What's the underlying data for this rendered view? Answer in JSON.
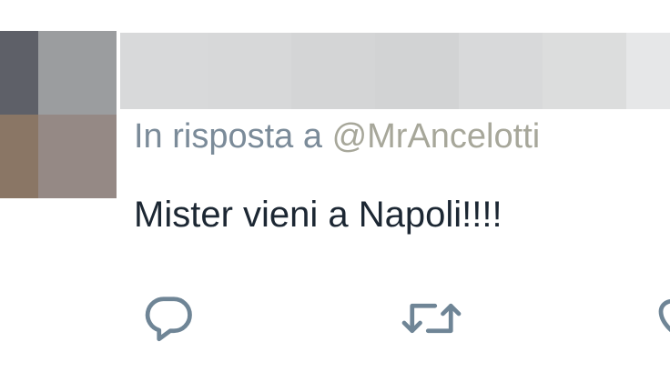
{
  "tweet": {
    "reply_prefix": "In risposta a",
    "reply_handle": "@MrAncelotti",
    "text": "Mister vieni a Napoli!!!!"
  },
  "actions": [
    {
      "name": "reply",
      "icon": "reply-icon"
    },
    {
      "name": "retweet",
      "icon": "retweet-icon"
    },
    {
      "name": "like",
      "icon": "heart-icon"
    }
  ],
  "colors": {
    "muted_text": "#7b8b99",
    "handle_text": "#a7a79a",
    "tweet_text": "#1c2733",
    "icon": "#6f8596"
  }
}
